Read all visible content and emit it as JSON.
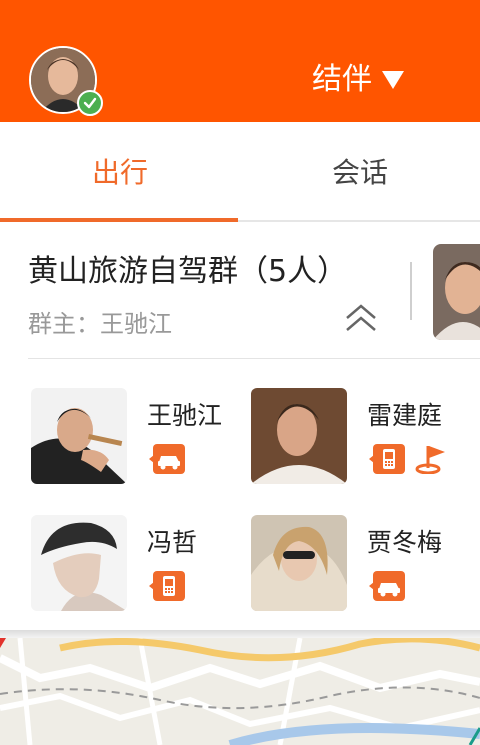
{
  "header": {
    "title": "结伴",
    "caret_icon": "triangle-down-icon",
    "avatar_icon": "user-avatar",
    "verified_icon": "check-icon",
    "accent": "#FF5500"
  },
  "tabs": [
    {
      "label": "出行",
      "active": true
    },
    {
      "label": "会话",
      "active": false
    }
  ],
  "group": {
    "name": "黄山旅游自驾群（5人）",
    "owner": "群主：王驰江",
    "collapse_icon": "double-chevron-up-icon"
  },
  "members": [
    {
      "name": "王驰江",
      "badges": [
        "car-icon"
      ]
    },
    {
      "name": "雷建庭",
      "badges": [
        "phone-icon",
        "flag-icon"
      ]
    },
    {
      "name": "冯哲",
      "badges": [
        "phone-icon"
      ]
    },
    {
      "name": "贾冬梅",
      "badges": [
        "car-icon"
      ]
    }
  ],
  "colors": {
    "tab_active": "#F06A2A",
    "badge": "#F06A2A",
    "verified": "#4CAF50"
  }
}
